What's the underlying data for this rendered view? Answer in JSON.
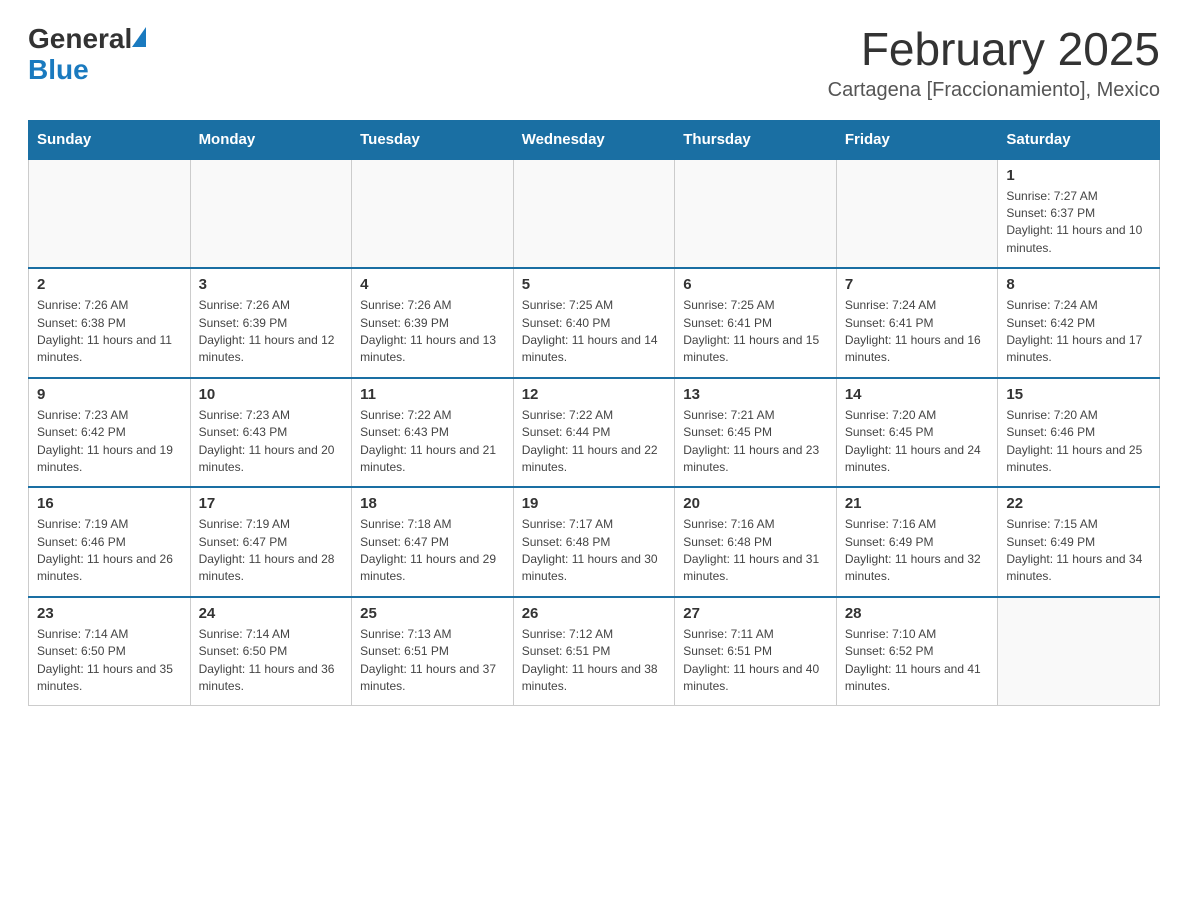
{
  "header": {
    "logo_general": "General",
    "logo_blue": "Blue",
    "month_title": "February 2025",
    "location": "Cartagena [Fraccionamiento], Mexico"
  },
  "weekdays": [
    "Sunday",
    "Monday",
    "Tuesday",
    "Wednesday",
    "Thursday",
    "Friday",
    "Saturday"
  ],
  "weeks": [
    [
      {
        "day": "",
        "info": ""
      },
      {
        "day": "",
        "info": ""
      },
      {
        "day": "",
        "info": ""
      },
      {
        "day": "",
        "info": ""
      },
      {
        "day": "",
        "info": ""
      },
      {
        "day": "",
        "info": ""
      },
      {
        "day": "1",
        "info": "Sunrise: 7:27 AM\nSunset: 6:37 PM\nDaylight: 11 hours and 10 minutes."
      }
    ],
    [
      {
        "day": "2",
        "info": "Sunrise: 7:26 AM\nSunset: 6:38 PM\nDaylight: 11 hours and 11 minutes."
      },
      {
        "day": "3",
        "info": "Sunrise: 7:26 AM\nSunset: 6:39 PM\nDaylight: 11 hours and 12 minutes."
      },
      {
        "day": "4",
        "info": "Sunrise: 7:26 AM\nSunset: 6:39 PM\nDaylight: 11 hours and 13 minutes."
      },
      {
        "day": "5",
        "info": "Sunrise: 7:25 AM\nSunset: 6:40 PM\nDaylight: 11 hours and 14 minutes."
      },
      {
        "day": "6",
        "info": "Sunrise: 7:25 AM\nSunset: 6:41 PM\nDaylight: 11 hours and 15 minutes."
      },
      {
        "day": "7",
        "info": "Sunrise: 7:24 AM\nSunset: 6:41 PM\nDaylight: 11 hours and 16 minutes."
      },
      {
        "day": "8",
        "info": "Sunrise: 7:24 AM\nSunset: 6:42 PM\nDaylight: 11 hours and 17 minutes."
      }
    ],
    [
      {
        "day": "9",
        "info": "Sunrise: 7:23 AM\nSunset: 6:42 PM\nDaylight: 11 hours and 19 minutes."
      },
      {
        "day": "10",
        "info": "Sunrise: 7:23 AM\nSunset: 6:43 PM\nDaylight: 11 hours and 20 minutes."
      },
      {
        "day": "11",
        "info": "Sunrise: 7:22 AM\nSunset: 6:43 PM\nDaylight: 11 hours and 21 minutes."
      },
      {
        "day": "12",
        "info": "Sunrise: 7:22 AM\nSunset: 6:44 PM\nDaylight: 11 hours and 22 minutes."
      },
      {
        "day": "13",
        "info": "Sunrise: 7:21 AM\nSunset: 6:45 PM\nDaylight: 11 hours and 23 minutes."
      },
      {
        "day": "14",
        "info": "Sunrise: 7:20 AM\nSunset: 6:45 PM\nDaylight: 11 hours and 24 minutes."
      },
      {
        "day": "15",
        "info": "Sunrise: 7:20 AM\nSunset: 6:46 PM\nDaylight: 11 hours and 25 minutes."
      }
    ],
    [
      {
        "day": "16",
        "info": "Sunrise: 7:19 AM\nSunset: 6:46 PM\nDaylight: 11 hours and 26 minutes."
      },
      {
        "day": "17",
        "info": "Sunrise: 7:19 AM\nSunset: 6:47 PM\nDaylight: 11 hours and 28 minutes."
      },
      {
        "day": "18",
        "info": "Sunrise: 7:18 AM\nSunset: 6:47 PM\nDaylight: 11 hours and 29 minutes."
      },
      {
        "day": "19",
        "info": "Sunrise: 7:17 AM\nSunset: 6:48 PM\nDaylight: 11 hours and 30 minutes."
      },
      {
        "day": "20",
        "info": "Sunrise: 7:16 AM\nSunset: 6:48 PM\nDaylight: 11 hours and 31 minutes."
      },
      {
        "day": "21",
        "info": "Sunrise: 7:16 AM\nSunset: 6:49 PM\nDaylight: 11 hours and 32 minutes."
      },
      {
        "day": "22",
        "info": "Sunrise: 7:15 AM\nSunset: 6:49 PM\nDaylight: 11 hours and 34 minutes."
      }
    ],
    [
      {
        "day": "23",
        "info": "Sunrise: 7:14 AM\nSunset: 6:50 PM\nDaylight: 11 hours and 35 minutes."
      },
      {
        "day": "24",
        "info": "Sunrise: 7:14 AM\nSunset: 6:50 PM\nDaylight: 11 hours and 36 minutes."
      },
      {
        "day": "25",
        "info": "Sunrise: 7:13 AM\nSunset: 6:51 PM\nDaylight: 11 hours and 37 minutes."
      },
      {
        "day": "26",
        "info": "Sunrise: 7:12 AM\nSunset: 6:51 PM\nDaylight: 11 hours and 38 minutes."
      },
      {
        "day": "27",
        "info": "Sunrise: 7:11 AM\nSunset: 6:51 PM\nDaylight: 11 hours and 40 minutes."
      },
      {
        "day": "28",
        "info": "Sunrise: 7:10 AM\nSunset: 6:52 PM\nDaylight: 11 hours and 41 minutes."
      },
      {
        "day": "",
        "info": ""
      }
    ]
  ]
}
